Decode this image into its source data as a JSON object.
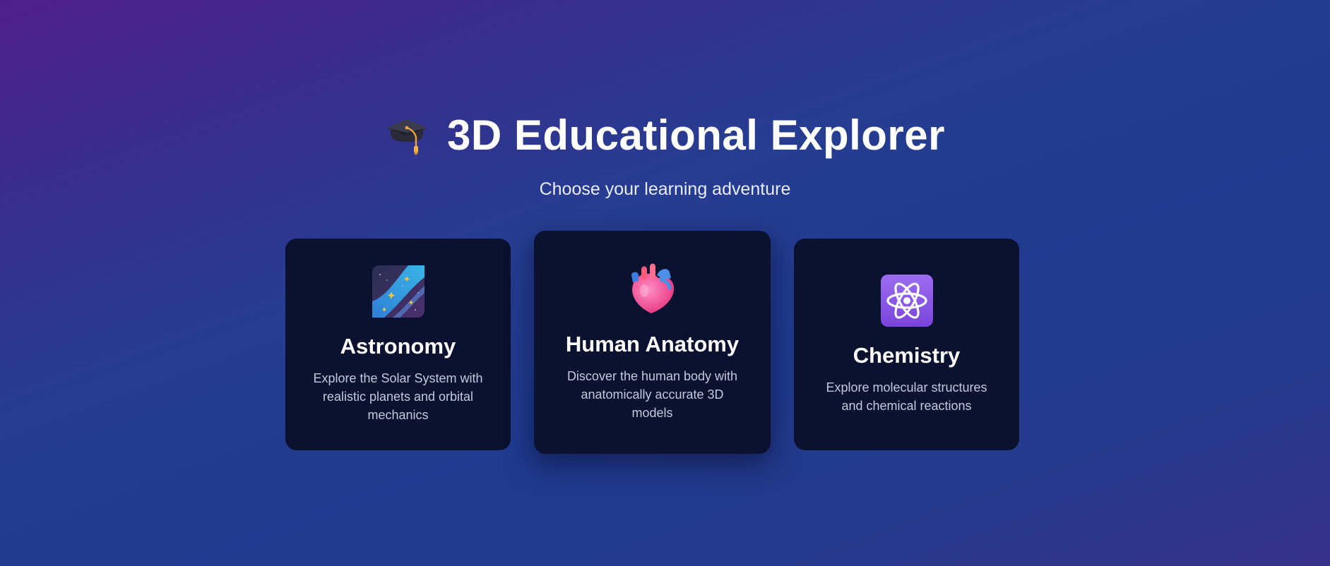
{
  "header": {
    "icon": "graduation-cap-icon",
    "title": "3D Educational Explorer",
    "subtitle": "Choose your learning adventure"
  },
  "cards": [
    {
      "icon": "milky-way-icon",
      "title": "Astronomy",
      "description": "Explore the Solar System with realistic planets and orbital mechanics"
    },
    {
      "icon": "anatomical-heart-icon",
      "title": "Human Anatomy",
      "description": "Discover the human body with anatomically accurate 3D models"
    },
    {
      "icon": "atom-symbol-icon",
      "title": "Chemistry",
      "description": "Explore molecular structures and chemical reactions"
    }
  ],
  "colors": {
    "background_start": "#4f1f8c",
    "background_end": "#1f3a8e",
    "card_background": "#0b1230",
    "card_text": "#c3c8dc"
  }
}
